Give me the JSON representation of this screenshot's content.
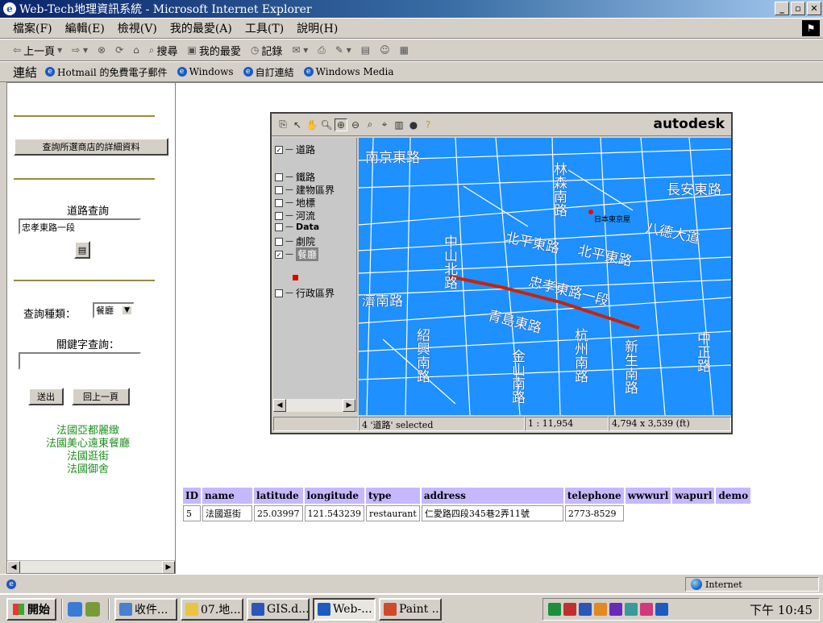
{
  "window": {
    "title": "Web-Tech地理資訊系統 - Microsoft Internet Explorer",
    "controls": [
      "_",
      "▫",
      "✕"
    ]
  },
  "menu": [
    "檔案(F)",
    "編輯(E)",
    "檢視(V)",
    "我的最愛(A)",
    "工具(T)",
    "說明(H)"
  ],
  "toolbar": {
    "back": "上一頁",
    "search": "搜尋",
    "favorites": "我的最愛",
    "history": "記錄"
  },
  "links": {
    "label": "連結",
    "items": [
      "Hotmail 的免費電子郵件",
      "Windows",
      "自訂連結",
      "Windows Media"
    ]
  },
  "left": {
    "detail_button": "查詢所選商店的詳細資料",
    "road_query_label": "道路查詢",
    "road_query_value": "忠孝東路一段",
    "type_label": "查詢種類：",
    "type_value": "餐廳",
    "keyword_label": "關鍵字查詢：",
    "keyword_value": "",
    "submit": "送出",
    "back": "回上一頁",
    "results": [
      "法國亞都麗緻",
      "法國美心遠東餐廳",
      "法國逛街",
      "法國御舍"
    ]
  },
  "viewer": {
    "brand": "autodesk",
    "layers": [
      {
        "name": "道路",
        "checked": true,
        "selected": false
      },
      {
        "name": "鐵路",
        "checked": false,
        "selected": false
      },
      {
        "name": "建物區界",
        "checked": false,
        "selected": false
      },
      {
        "name": "地標",
        "checked": false,
        "selected": false
      },
      {
        "name": "河流",
        "checked": false,
        "selected": false
      },
      {
        "name": "Data",
        "checked": false,
        "selected": false
      },
      {
        "name": "劇院",
        "checked": false,
        "selected": false
      },
      {
        "name": "餐廳",
        "checked": true,
        "selected": true
      },
      {
        "name": "行政區界",
        "checked": false,
        "selected": false
      }
    ],
    "map_labels": [
      "南京東路",
      "長安東路",
      "日本東京屋",
      "八德大道",
      "北平東路",
      "北平東路",
      "忠孝東路一段",
      "青島東路",
      "中山北路",
      "林森南路",
      "濟南路",
      "紹興南路",
      "杭州南路",
      "新生南路",
      "金山南路",
      "中正路"
    ],
    "status": {
      "selected": "4 '道路' selected",
      "scale": "1 : 11,954",
      "extent": "4,794 x 3,539 (ft)"
    },
    "colors": {
      "water": "#1e90ff",
      "road": "#ffffff",
      "selected_road": "#cc2200"
    }
  },
  "table": {
    "headers": [
      "ID",
      "name",
      "latitude",
      "longitude",
      "type",
      "address",
      "telephone",
      "wwwurl",
      "wapurl",
      "demo"
    ],
    "rows": [
      [
        "5",
        "法國逛街",
        "25.03997",
        "121.543239",
        "restaurant",
        "仁愛路四段345巷2弄11號",
        "2773-8529",
        "",
        "",
        ""
      ]
    ]
  },
  "browser_status": {
    "zone": "Internet"
  },
  "taskbar": {
    "start": "開始",
    "tasks": [
      "收件...",
      "07.地...",
      "GIS.d...",
      "Web-...",
      "Paint ..."
    ],
    "clock": "下午 10:45"
  }
}
